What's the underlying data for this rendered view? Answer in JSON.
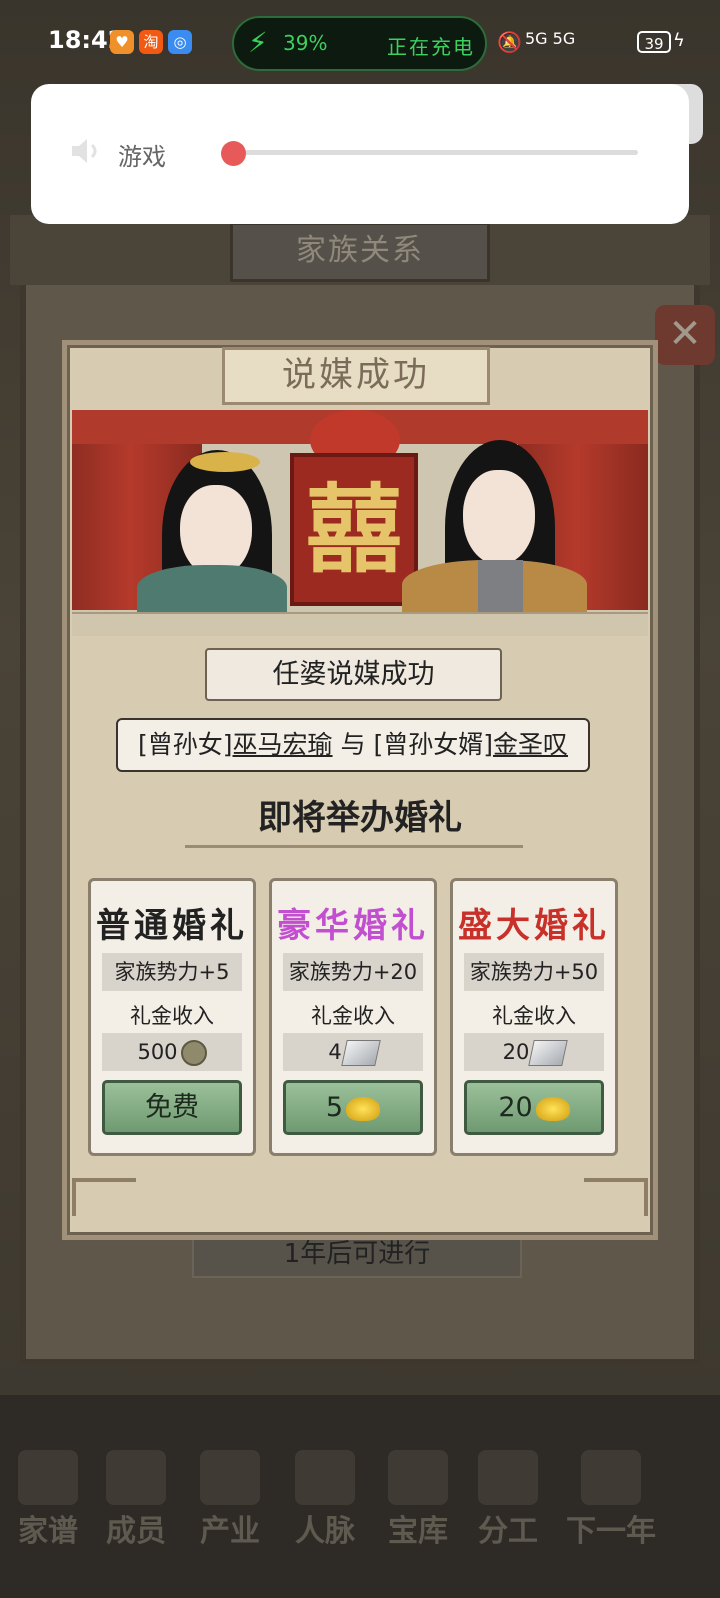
{
  "status_bar": {
    "time": "18:42",
    "apps": [
      "heart-app-icon",
      "taobao-icon",
      "browser-icon"
    ],
    "taobao_glyph": "淘",
    "battery_percent": "39%",
    "charging_text": "正在充电",
    "signal_text": "5G 5G",
    "battery_level": "39"
  },
  "volume_panel": {
    "label": "游戏",
    "level": 0
  },
  "background": {
    "screen_title": "家族关系",
    "bottom_text": "1年后可进行",
    "close_glyph": "✕",
    "nav": [
      "家谱",
      "成员",
      "产业",
      "人脉",
      "宝库",
      "分工",
      "下一年"
    ]
  },
  "dialog": {
    "title": "说媒成功",
    "double_happiness": "囍",
    "matchmaker_text": "任婆说媒成功",
    "couple": {
      "bride_role": "[曾孙女]",
      "bride_name": "巫马宏瑜",
      "conj": "与",
      "groom_role": "[曾孙女婿]",
      "groom_name": "金圣叹"
    },
    "soon_text": "即将举办婚礼",
    "weddings": [
      {
        "title": "普通婚礼",
        "color": "#222222",
        "power": "家族势力+5",
        "income_label": "礼金收入",
        "income": "500",
        "income_icon": "copper-coin-icon",
        "cost": "免费",
        "cost_icon": ""
      },
      {
        "title": "豪华婚礼",
        "color": "#c24fd0",
        "power": "家族势力+20",
        "income_label": "礼金收入",
        "income": "4",
        "income_icon": "silver-ingot-icon",
        "cost": "5",
        "cost_icon": "gold-ingot-icon"
      },
      {
        "title": "盛大婚礼",
        "color": "#c8302a",
        "power": "家族势力+50",
        "income_label": "礼金收入",
        "income": "20",
        "income_icon": "silver-ingot-icon",
        "cost": "20",
        "cost_icon": "gold-ingot-icon"
      }
    ]
  }
}
